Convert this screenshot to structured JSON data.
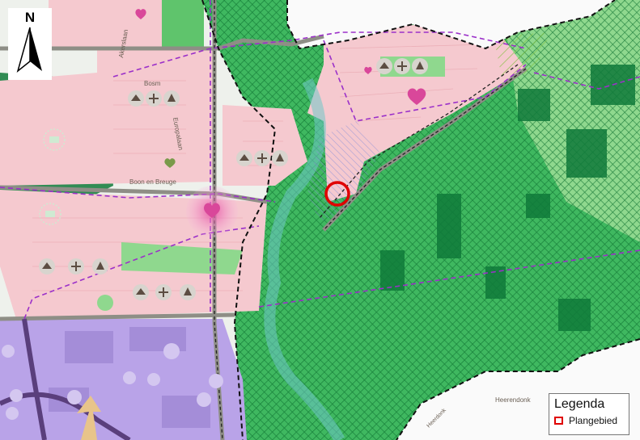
{
  "north": {
    "letter": "N"
  },
  "legend": {
    "title": "Legenda",
    "items": [
      {
        "label": "Plangebied",
        "color": "#e00000"
      }
    ]
  },
  "labels": {
    "street1": "Akerslaan",
    "street2": "Bosm",
    "street3": "Europalaan",
    "street4": "Boon en Breuge",
    "place1": "Heerendonk",
    "street5": "Heerdonk"
  },
  "colors": {
    "residential": "#f5c9cf",
    "nature": "#1e9e4a",
    "forest": "#0f7a3a",
    "industrial": "#b9a3e8",
    "boundary": "#9b30c9",
    "plan_circle": "#e00000"
  }
}
